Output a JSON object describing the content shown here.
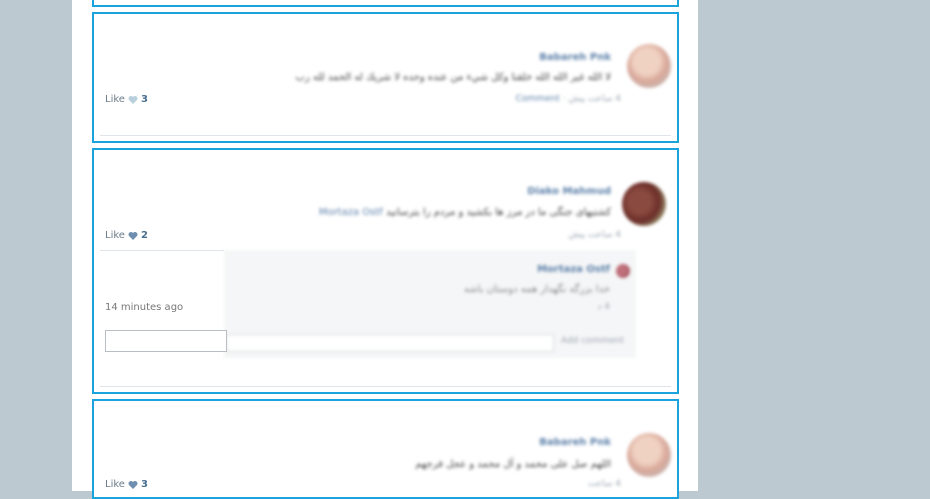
{
  "posts": [
    {
      "author": "Babareh Pnk",
      "text": "لا الله غير الله الله خلقنا وكل شيء من عنده وحده لا شريك له الحمد لله رب",
      "meta": "4 ساعت پیش",
      "comment_link": "Comment",
      "like_label": "Like",
      "like_count": "3",
      "heart_color": "#b9cfdc"
    },
    {
      "author": "Diako Mahmud",
      "text": "کشتیهای جنگی ما در مرز ها بکشید و مردم را بترسانید",
      "mention": "Mortaza Ostf",
      "meta": "4 ساعت پیش",
      "like_label": "Like",
      "like_count": "2",
      "heart_color": "#6f8fb0",
      "reply": {
        "author": "Mortaza Ostf",
        "text": "خدا بزرگه نگهدار همه دوستان باشه",
        "meta": "4 د",
        "timestamp": "14 minutes ago",
        "input_placeholder": "Add comment"
      }
    },
    {
      "author": "Babareh Pnk",
      "text": "اللهم صل علی محمد و آل محمد و عجل فرجهم",
      "meta": "4 ساعت",
      "like_label": "Like",
      "like_count": "3",
      "heart_color": "#6f8fb0"
    }
  ]
}
